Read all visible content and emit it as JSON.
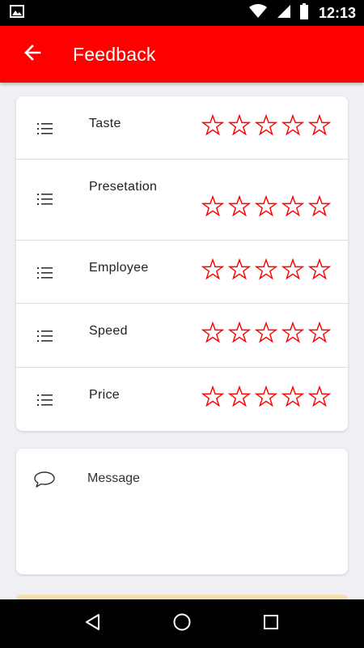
{
  "status_bar": {
    "time": "12:13",
    "icons": [
      "image-icon",
      "wifi-icon",
      "signal-icon",
      "battery-icon"
    ]
  },
  "app_bar": {
    "title": "Feedback",
    "back_icon": "arrow-left-icon",
    "color": "#ff0000"
  },
  "ratings": {
    "items": [
      {
        "label": "Taste",
        "rating": 0,
        "max": 5
      },
      {
        "label": "Presetation",
        "rating": 0,
        "max": 5
      },
      {
        "label": "Employee",
        "rating": 0,
        "max": 5
      },
      {
        "label": "Speed",
        "rating": 0,
        "max": 5
      },
      {
        "label": "Price",
        "rating": 0,
        "max": 5
      }
    ],
    "row_icon": "list-icon",
    "star_color": "#ff0000"
  },
  "message": {
    "placeholder": "Message",
    "value": "",
    "icon": "chat-bubble-icon"
  },
  "nav_bar": {
    "icons": [
      "back-triangle-icon",
      "home-circle-icon",
      "recents-square-icon"
    ]
  }
}
